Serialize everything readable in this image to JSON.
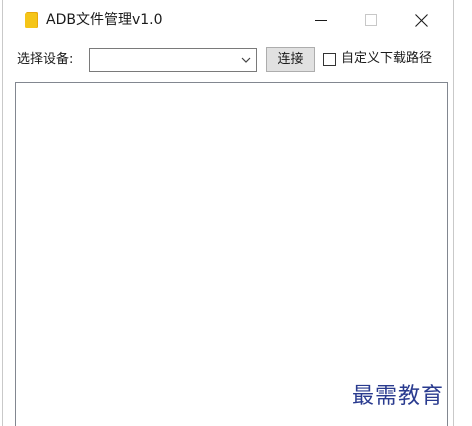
{
  "window": {
    "title": "ADB文件管理v1.0",
    "app_icon": "folder-icon",
    "minimize_icon": "minimize-icon",
    "maximize_icon": "maximize-icon",
    "close_icon": "close-icon"
  },
  "toolbar": {
    "device_label": "选择设备:",
    "device_select_value": "",
    "connect_label": "连接",
    "custom_path_label": "自定义下载路径",
    "custom_path_checked": false
  },
  "watermark": "最需教育",
  "colors": {
    "folder_icon": "#f5c518",
    "watermark": "#2a3b8f",
    "button_bg": "#e1e1e1"
  }
}
